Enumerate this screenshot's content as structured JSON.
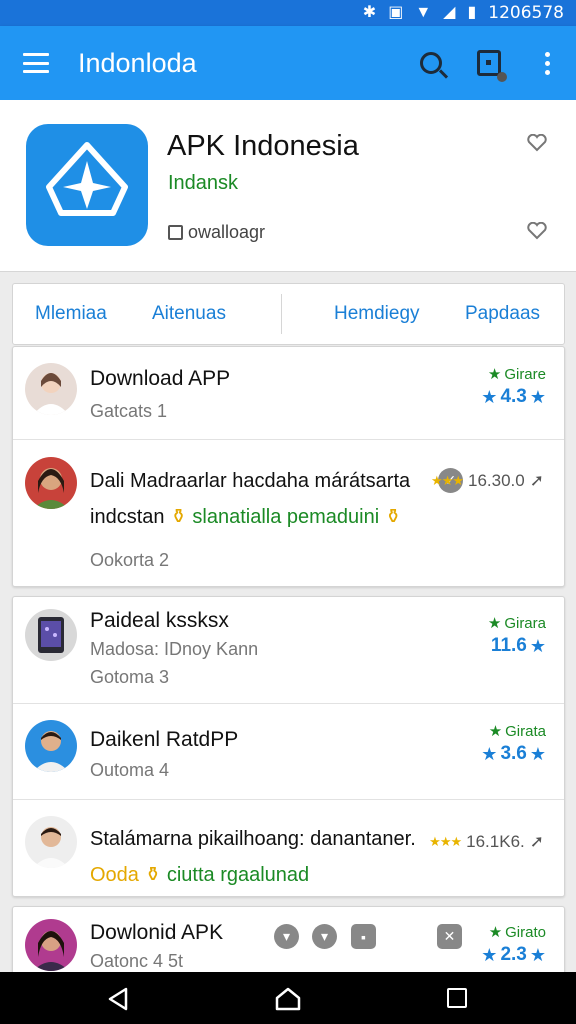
{
  "status_bar": {
    "icons": [
      "bug-icon",
      "vibrate-icon",
      "wifi-icon",
      "signal-icon",
      "battery-icon"
    ],
    "time": "1206578"
  },
  "app_bar": {
    "title": "Indonloda",
    "actions": [
      "search-icon",
      "install-icon",
      "more-vert-icon"
    ],
    "background": "#2196f3"
  },
  "app": {
    "name": "APK Indonesia",
    "developer": "Indansk",
    "download_label": "owalloagr",
    "icon_color": "#1f8fe6"
  },
  "tabs": [
    "Mlemiaa",
    "Aitenuas",
    "Hemdiegy",
    "Papdaas"
  ],
  "items": [
    {
      "title": "Download APP",
      "meta": "Gatcats 1",
      "badge": "Girare",
      "rating": "4.3"
    },
    {
      "title": "Dali Madraarlar hacdaha márátsarta",
      "subtitle_prefix": "indcstan",
      "subtitle_emoji": "⚱",
      "subtitle_green": "slanatialla pemaduini",
      "subtitle_emoji2": "⚱",
      "meta": "Ookorta 2",
      "stats": "16.30.0"
    },
    {
      "title": "Paideal kssksx",
      "subtitle": "Madosa: IDnoy Kann",
      "meta": "Gotoma 3",
      "badge": "Girara",
      "rating": "11.6"
    },
    {
      "title": "Daikenl RatdPP",
      "meta": "Outoma 4",
      "badge": "Girata",
      "rating": "3.6"
    },
    {
      "title": "Stalámarna pikailhoang: danantaner.",
      "subtitle_gold": "Ooda",
      "subtitle_emoji": "⚱",
      "subtitle_rest": "ciutta rgaalunad",
      "stats": "16.1K6."
    },
    {
      "title": "Dowlonid APK",
      "meta": "Oatonc 4 5t",
      "badge": "Girato",
      "rating": "2.3"
    }
  ],
  "nav": [
    "back-icon",
    "home-icon",
    "recents-icon"
  ]
}
